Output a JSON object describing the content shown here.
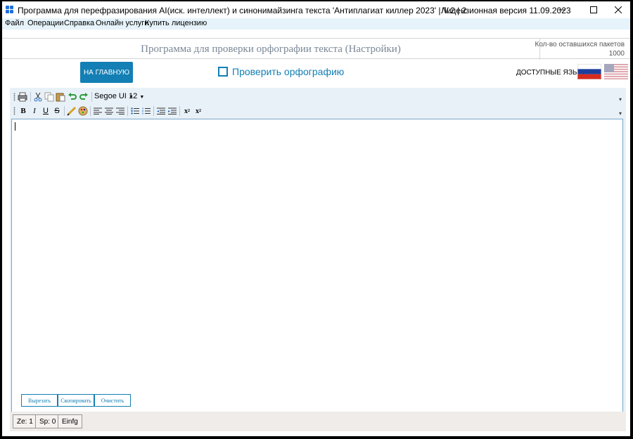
{
  "window": {
    "title": "Программа для перефразирования AI(иск. интеллект) и синонимайзинга текста 'Антиплагиат киллер 2023' | V.2 | 2",
    "license": "Лицензионная версия 11.09.2023"
  },
  "menu": [
    "Файл",
    "Операции",
    "Справка",
    "Онлайн услуги",
    "Купить лицензию"
  ],
  "header": {
    "title": "Программа для проверки орфографии текста (Настройки)",
    "packets_label": "Кол-во оставшихся пакетов",
    "packets_value": "1000"
  },
  "controls": {
    "home_button": "НА ГЛАВНУЮ",
    "spellcheck_label": "Проверить орфографию",
    "spellcheck_checked": false,
    "languages_label": "ДОСТУПНЫЕ ЯЗЫКИ"
  },
  "toolbar": {
    "font_name": "Segoe UI",
    "font_size": "12",
    "icons_row1": [
      "print-icon",
      "cut-icon",
      "copy-icon",
      "paste-icon",
      "undo-icon",
      "redo-icon"
    ],
    "icons_row2": [
      "bold-icon",
      "italic-icon",
      "underline-icon",
      "strikethrough-icon",
      "highlight-icon",
      "color-icon",
      "align-left-icon",
      "align-center-icon",
      "align-right-icon",
      "bullet-list-icon",
      "numbered-list-icon",
      "outdent-icon",
      "indent-icon",
      "subscript-icon",
      "superscript-icon"
    ]
  },
  "editor": {
    "content": ""
  },
  "actions": [
    "Вырезать",
    "Скопировать",
    "Очистить"
  ],
  "status": {
    "ze": "Ze: 1",
    "sp": "Sp: 0",
    "mode": "Einfg"
  }
}
